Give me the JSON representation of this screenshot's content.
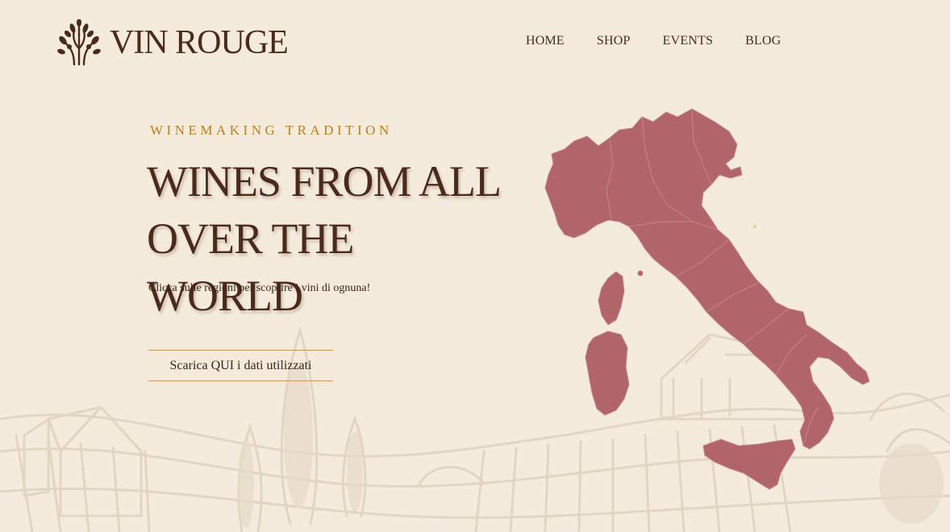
{
  "brand": {
    "name": "VIN ROUGE",
    "logo_icon": "tree-icon"
  },
  "nav": {
    "items": [
      {
        "label": "HOME"
      },
      {
        "label": "SHOP"
      },
      {
        "label": "EVENTS"
      },
      {
        "label": "BLOG"
      }
    ]
  },
  "hero": {
    "eyebrow": "WINEMAKING TRADITION",
    "headline_line1": "WINES FROM ALL",
    "headline_line2": "OVER THE WORLD",
    "subtext": "Clicca sulle regioni per scoprire i vini di ognuna!",
    "button_label": "Scarica QUI i dati utilizzati"
  },
  "map": {
    "country": "Italy",
    "fill_color": "#b1656a",
    "border_color": "#c88a8d"
  },
  "colors": {
    "background": "#f5ebdc",
    "text": "#4a2a1c",
    "accent": "#b8801f",
    "sketch": "#e4d8c6"
  }
}
